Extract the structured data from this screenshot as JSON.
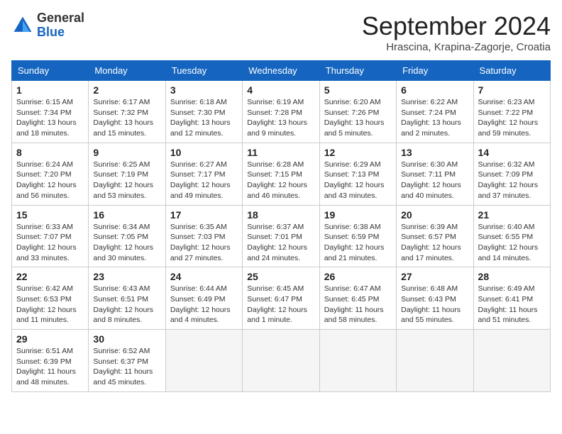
{
  "header": {
    "logo_general": "General",
    "logo_blue": "Blue",
    "month_title": "September 2024",
    "location": "Hrascina, Krapina-Zagorje, Croatia"
  },
  "weekdays": [
    "Sunday",
    "Monday",
    "Tuesday",
    "Wednesday",
    "Thursday",
    "Friday",
    "Saturday"
  ],
  "weeks": [
    [
      {
        "day": "1",
        "info": "Sunrise: 6:15 AM\nSunset: 7:34 PM\nDaylight: 13 hours and 18 minutes."
      },
      {
        "day": "2",
        "info": "Sunrise: 6:17 AM\nSunset: 7:32 PM\nDaylight: 13 hours and 15 minutes."
      },
      {
        "day": "3",
        "info": "Sunrise: 6:18 AM\nSunset: 7:30 PM\nDaylight: 13 hours and 12 minutes."
      },
      {
        "day": "4",
        "info": "Sunrise: 6:19 AM\nSunset: 7:28 PM\nDaylight: 13 hours and 9 minutes."
      },
      {
        "day": "5",
        "info": "Sunrise: 6:20 AM\nSunset: 7:26 PM\nDaylight: 13 hours and 5 minutes."
      },
      {
        "day": "6",
        "info": "Sunrise: 6:22 AM\nSunset: 7:24 PM\nDaylight: 13 hours and 2 minutes."
      },
      {
        "day": "7",
        "info": "Sunrise: 6:23 AM\nSunset: 7:22 PM\nDaylight: 12 hours and 59 minutes."
      }
    ],
    [
      {
        "day": "8",
        "info": "Sunrise: 6:24 AM\nSunset: 7:20 PM\nDaylight: 12 hours and 56 minutes."
      },
      {
        "day": "9",
        "info": "Sunrise: 6:25 AM\nSunset: 7:19 PM\nDaylight: 12 hours and 53 minutes."
      },
      {
        "day": "10",
        "info": "Sunrise: 6:27 AM\nSunset: 7:17 PM\nDaylight: 12 hours and 49 minutes."
      },
      {
        "day": "11",
        "info": "Sunrise: 6:28 AM\nSunset: 7:15 PM\nDaylight: 12 hours and 46 minutes."
      },
      {
        "day": "12",
        "info": "Sunrise: 6:29 AM\nSunset: 7:13 PM\nDaylight: 12 hours and 43 minutes."
      },
      {
        "day": "13",
        "info": "Sunrise: 6:30 AM\nSunset: 7:11 PM\nDaylight: 12 hours and 40 minutes."
      },
      {
        "day": "14",
        "info": "Sunrise: 6:32 AM\nSunset: 7:09 PM\nDaylight: 12 hours and 37 minutes."
      }
    ],
    [
      {
        "day": "15",
        "info": "Sunrise: 6:33 AM\nSunset: 7:07 PM\nDaylight: 12 hours and 33 minutes."
      },
      {
        "day": "16",
        "info": "Sunrise: 6:34 AM\nSunset: 7:05 PM\nDaylight: 12 hours and 30 minutes."
      },
      {
        "day": "17",
        "info": "Sunrise: 6:35 AM\nSunset: 7:03 PM\nDaylight: 12 hours and 27 minutes."
      },
      {
        "day": "18",
        "info": "Sunrise: 6:37 AM\nSunset: 7:01 PM\nDaylight: 12 hours and 24 minutes."
      },
      {
        "day": "19",
        "info": "Sunrise: 6:38 AM\nSunset: 6:59 PM\nDaylight: 12 hours and 21 minutes."
      },
      {
        "day": "20",
        "info": "Sunrise: 6:39 AM\nSunset: 6:57 PM\nDaylight: 12 hours and 17 minutes."
      },
      {
        "day": "21",
        "info": "Sunrise: 6:40 AM\nSunset: 6:55 PM\nDaylight: 12 hours and 14 minutes."
      }
    ],
    [
      {
        "day": "22",
        "info": "Sunrise: 6:42 AM\nSunset: 6:53 PM\nDaylight: 12 hours and 11 minutes."
      },
      {
        "day": "23",
        "info": "Sunrise: 6:43 AM\nSunset: 6:51 PM\nDaylight: 12 hours and 8 minutes."
      },
      {
        "day": "24",
        "info": "Sunrise: 6:44 AM\nSunset: 6:49 PM\nDaylight: 12 hours and 4 minutes."
      },
      {
        "day": "25",
        "info": "Sunrise: 6:45 AM\nSunset: 6:47 PM\nDaylight: 12 hours and 1 minute."
      },
      {
        "day": "26",
        "info": "Sunrise: 6:47 AM\nSunset: 6:45 PM\nDaylight: 11 hours and 58 minutes."
      },
      {
        "day": "27",
        "info": "Sunrise: 6:48 AM\nSunset: 6:43 PM\nDaylight: 11 hours and 55 minutes."
      },
      {
        "day": "28",
        "info": "Sunrise: 6:49 AM\nSunset: 6:41 PM\nDaylight: 11 hours and 51 minutes."
      }
    ],
    [
      {
        "day": "29",
        "info": "Sunrise: 6:51 AM\nSunset: 6:39 PM\nDaylight: 11 hours and 48 minutes."
      },
      {
        "day": "30",
        "info": "Sunrise: 6:52 AM\nSunset: 6:37 PM\nDaylight: 11 hours and 45 minutes."
      },
      {
        "day": "",
        "info": ""
      },
      {
        "day": "",
        "info": ""
      },
      {
        "day": "",
        "info": ""
      },
      {
        "day": "",
        "info": ""
      },
      {
        "day": "",
        "info": ""
      }
    ]
  ]
}
